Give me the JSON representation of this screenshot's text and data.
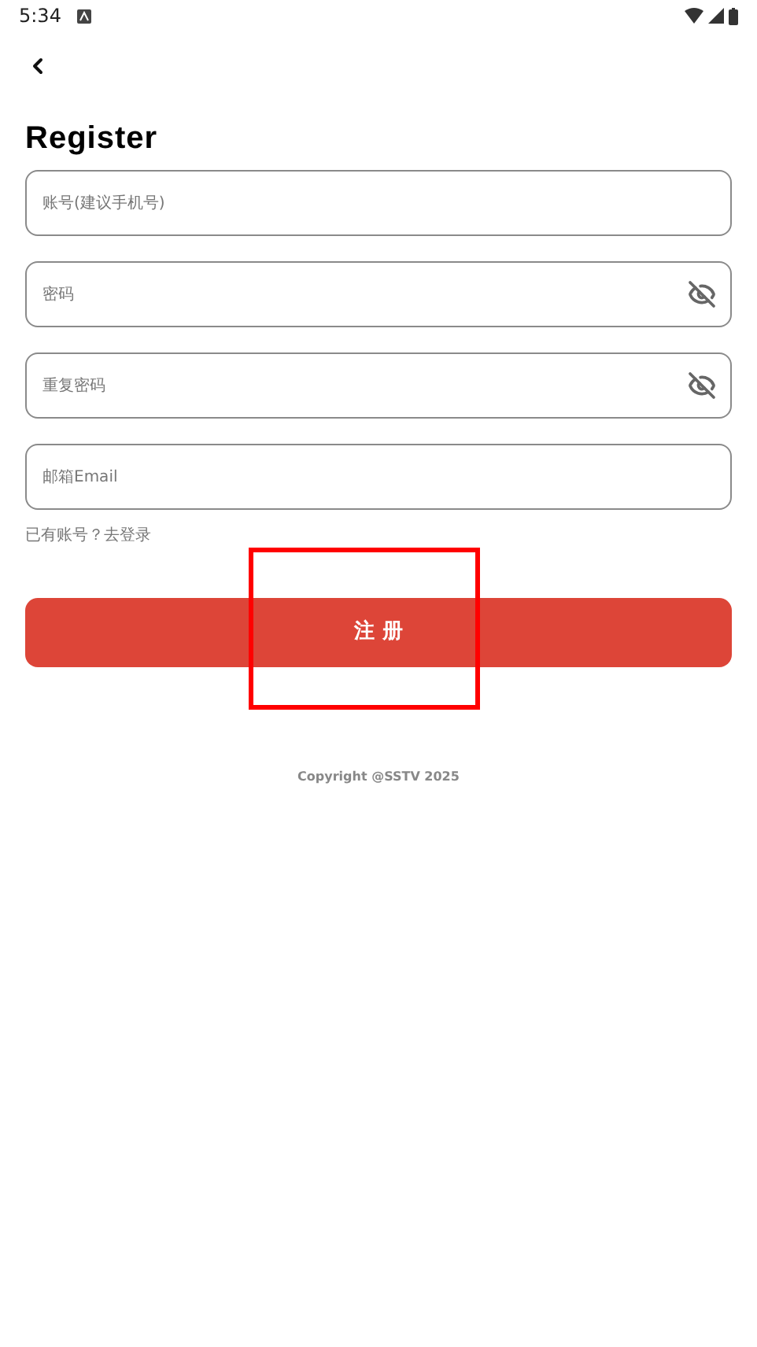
{
  "status_bar": {
    "time": "5:34"
  },
  "title": "Register",
  "fields": [
    {
      "kind": "text",
      "placeholder": "账号(建议手机号)"
    },
    {
      "kind": "password",
      "placeholder": "密码"
    },
    {
      "kind": "password",
      "placeholder": "重复密码"
    },
    {
      "kind": "text",
      "placeholder": "邮箱Email"
    }
  ],
  "login_link": "已有账号？去登录",
  "submit_button": "注 册",
  "copyright": "Copyright @SSTV  2025"
}
